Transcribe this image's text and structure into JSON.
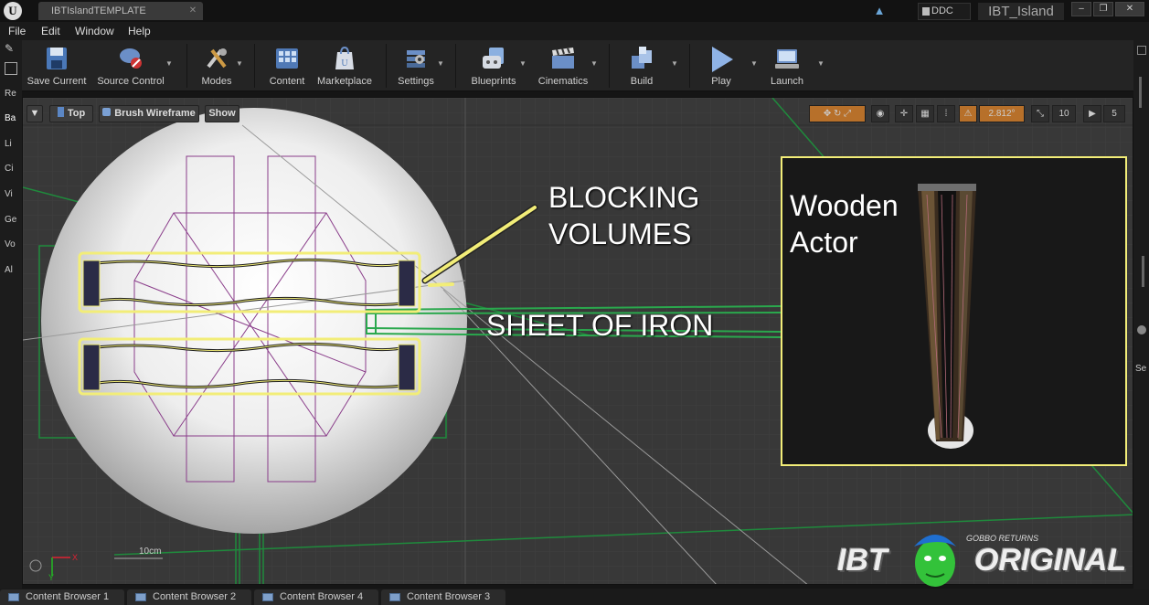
{
  "window": {
    "tab_title": "IBTIslandTEMPLATE",
    "tab_close": "✕",
    "ddc_label": "DDC",
    "project_name": "IBT_Island",
    "minimize": "‒",
    "restore": "❐",
    "close": "✕"
  },
  "menu": [
    "File",
    "Edit",
    "Window",
    "Help"
  ],
  "toolbar": {
    "items": [
      {
        "label": "Save Current",
        "icon": "save-icon"
      },
      {
        "label": "Source Control",
        "icon": "source-control-icon"
      },
      {
        "label": "Modes",
        "icon": "modes-icon"
      },
      {
        "label": "Content",
        "icon": "content-icon"
      },
      {
        "label": "Marketplace",
        "icon": "marketplace-icon"
      },
      {
        "label": "Settings",
        "icon": "settings-icon"
      },
      {
        "label": "Blueprints",
        "icon": "blueprints-icon"
      },
      {
        "label": "Cinematics",
        "icon": "cinematics-icon"
      },
      {
        "label": "Build",
        "icon": "build-icon"
      },
      {
        "label": "Play",
        "icon": "play-icon"
      },
      {
        "label": "Launch",
        "icon": "launch-icon"
      }
    ]
  },
  "left_panel": [
    "Re",
    "Ba",
    "Li",
    "Ci",
    "Vi",
    "Ge",
    "Vo",
    "Al"
  ],
  "right_panel": [
    "Se"
  ],
  "viewport": {
    "view_mode": "Top",
    "render_mode": "Brush Wireframe",
    "show_label": "Show",
    "rotation_snap": "2.812°",
    "scale_snap": "10",
    "camera_speed": "5",
    "scale_label": "10cm",
    "axis_x": "X",
    "axis_y": "Y"
  },
  "annotations": {
    "blocking_line1": "BLOCKING",
    "blocking_line2": "VOLUMES",
    "sheet_of_iron": "SHEET OF IRON",
    "inset_line1": "Wooden",
    "inset_line2": "Actor"
  },
  "watermark": {
    "left": "IBT",
    "right": "ORIGINAL",
    "small": "GOBBO RETURNS"
  },
  "bottom_tabs": [
    "Content Browser 1",
    "Content Browser 2",
    "Content Browser 4",
    "Content Browser 3"
  ],
  "colors": {
    "highlight_yellow": "#f2ed78",
    "wire_green": "#1f8a3c",
    "wire_purple": "#8a3d8a",
    "viewport_bg": "#383838"
  }
}
